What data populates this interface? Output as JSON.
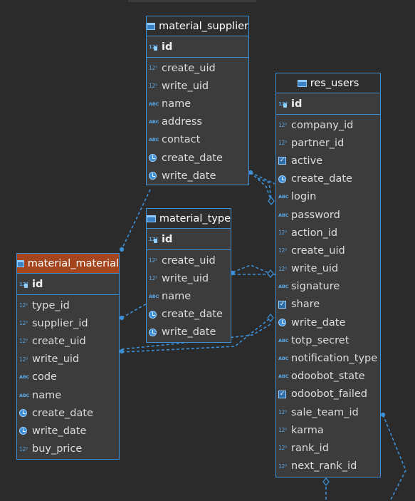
{
  "entities": {
    "material_supplier": {
      "title": "material_supplier",
      "pk": "id",
      "columns": [
        {
          "name": "create_uid",
          "type": "123"
        },
        {
          "name": "write_uid",
          "type": "123"
        },
        {
          "name": "name",
          "type": "ABC"
        },
        {
          "name": "address",
          "type": "ABC"
        },
        {
          "name": "contact",
          "type": "ABC"
        },
        {
          "name": "create_date",
          "type": "date"
        },
        {
          "name": "write_date",
          "type": "date"
        }
      ]
    },
    "material_type": {
      "title": "material_type",
      "pk": "id",
      "columns": [
        {
          "name": "create_uid",
          "type": "123"
        },
        {
          "name": "write_uid",
          "type": "123"
        },
        {
          "name": "name",
          "type": "ABC"
        },
        {
          "name": "create_date",
          "type": "date"
        },
        {
          "name": "write_date",
          "type": "date"
        }
      ]
    },
    "material_material": {
      "title": "material_material",
      "pk": "id",
      "columns": [
        {
          "name": "type_id",
          "type": "123"
        },
        {
          "name": "supplier_id",
          "type": "123"
        },
        {
          "name": "create_uid",
          "type": "123"
        },
        {
          "name": "write_uid",
          "type": "123"
        },
        {
          "name": "code",
          "type": "ABC"
        },
        {
          "name": "name",
          "type": "ABC"
        },
        {
          "name": "create_date",
          "type": "date"
        },
        {
          "name": "write_date",
          "type": "date"
        },
        {
          "name": "buy_price",
          "type": "123"
        }
      ]
    },
    "res_users": {
      "title": "res_users",
      "pk": "id",
      "columns": [
        {
          "name": "company_id",
          "type": "123"
        },
        {
          "name": "partner_id",
          "type": "123"
        },
        {
          "name": "active",
          "type": "bool"
        },
        {
          "name": "create_date",
          "type": "date"
        },
        {
          "name": "login",
          "type": "ABC"
        },
        {
          "name": "password",
          "type": "ABC"
        },
        {
          "name": "action_id",
          "type": "123"
        },
        {
          "name": "create_uid",
          "type": "123"
        },
        {
          "name": "write_uid",
          "type": "123"
        },
        {
          "name": "signature",
          "type": "ABC"
        },
        {
          "name": "share",
          "type": "bool"
        },
        {
          "name": "write_date",
          "type": "date"
        },
        {
          "name": "totp_secret",
          "type": "ABC"
        },
        {
          "name": "notification_type",
          "type": "ABC"
        },
        {
          "name": "odoobot_state",
          "type": "ABC"
        },
        {
          "name": "odoobot_failed",
          "type": "bool"
        },
        {
          "name": "sale_team_id",
          "type": "123"
        },
        {
          "name": "karma",
          "type": "123"
        },
        {
          "name": "rank_id",
          "type": "123"
        },
        {
          "name": "next_rank_id",
          "type": "123"
        }
      ]
    }
  },
  "icons": {
    "pk": "12³",
    "123": "12³",
    "ABC": "ABC"
  },
  "colors": {
    "background": "#2b2b2b",
    "border": "#3d8fd6",
    "selected_header": "#a5451d",
    "link": "#3d8fd6"
  }
}
